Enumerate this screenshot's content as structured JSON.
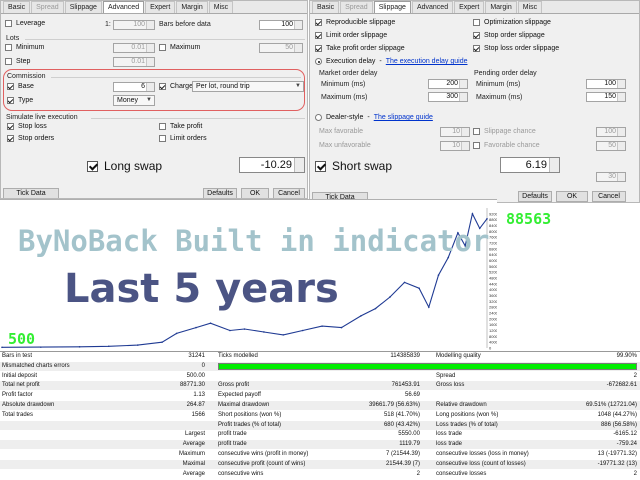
{
  "left_panel": {
    "tabs": [
      {
        "label": "Basic",
        "state": "normal"
      },
      {
        "label": "Spread",
        "state": "disabled"
      },
      {
        "label": "Slippage",
        "state": "normal"
      },
      {
        "label": "Advanced",
        "state": "active"
      },
      {
        "label": "Expert",
        "state": "normal"
      },
      {
        "label": "Margin",
        "state": "normal"
      },
      {
        "label": "Misc",
        "state": "normal"
      }
    ],
    "leverage_label": "Leverage",
    "leverage_ratio": "1:",
    "leverage_value": "100",
    "bars_before_data_label": "Bars before data",
    "bars_before_data_value": "100",
    "lots_label": "Lots",
    "minimum_label": "Minimum",
    "minimum_value": "0.01",
    "maximum_label": "Maximum",
    "maximum_value": "50",
    "step_label": "Step",
    "step_value": "0.01",
    "commission_label": "Commission",
    "base_label": "Base",
    "base_value": "6",
    "charged_label": "Charged",
    "charged_value": "Per lot, round trip",
    "type_label": "Type",
    "type_value": "Money",
    "simulate_label": "Simulate live execution",
    "stop_loss_label": "Stop loss",
    "take_profit_label": "Take profit",
    "stop_orders_label": "Stop orders",
    "limit_orders_label": "Limit orders",
    "long_swap_label": "Long swap",
    "long_swap_value": "-10.29",
    "tick_data_manager": "Tick Data Manager",
    "defaults_label": "Defaults",
    "ok_label": "OK",
    "cancel_label": "Cancel"
  },
  "right_panel": {
    "tabs": [
      {
        "label": "Basic",
        "state": "normal"
      },
      {
        "label": "Spread",
        "state": "disabled"
      },
      {
        "label": "Slippage",
        "state": "active"
      },
      {
        "label": "Advanced",
        "state": "normal"
      },
      {
        "label": "Expert",
        "state": "normal"
      },
      {
        "label": "Margin",
        "state": "normal"
      },
      {
        "label": "Misc",
        "state": "normal"
      }
    ],
    "reproducible_slippage": "Reproducible slippage",
    "optimization_slippage": "Optimization slippage",
    "limit_order_slippage": "Limit order slippage",
    "stop_order_slippage": "Stop order slippage",
    "take_profit_order_slippage": "Take profit order slippage",
    "stop_loss_order_slippage": "Stop loss order slippage",
    "execution_delay": "Execution delay",
    "execution_delay_dash": "-",
    "execution_delay_guide": "The execution delay guide",
    "market_order_delay": "Market order delay",
    "pending_order_delay": "Pending order delay",
    "minimum_ms_label": "Minimum (ms)",
    "maximum_ms_label": "Maximum (ms)",
    "market_min": "200",
    "market_max": "300",
    "pending_min": "100",
    "pending_max": "150",
    "dealer_style": "Dealer-style",
    "dealer_style_dash": "-",
    "slippage_guide": "The slippage guide",
    "max_favorable": "Max favorable",
    "max_favorable_value": "10",
    "slippage_chance": "Slippage chance",
    "slippage_chance_value": "100",
    "max_unfavorable": "Max unfavorable",
    "max_unfavorable_value": "10",
    "favorable_chance": "Favorable chance",
    "favorable_chance_value": "50",
    "extra_value": "30",
    "short_swap_label": "Short swap",
    "short_swap_value": "6.19",
    "tick_data_manager": "Tick Data Manager",
    "defaults_label": "Defaults",
    "ok_label": "OK",
    "cancel_label": "Cancel"
  },
  "overlay": {
    "title": "ByNoBack Built in indicator",
    "subtitle": "Last 5 years",
    "end_value": "88563",
    "start_value": "500"
  },
  "chart_data": {
    "type": "line",
    "title": "",
    "xlabel": "",
    "ylabel": "",
    "ylim": [
      0,
      96000
    ],
    "yticks": [
      0,
      4000,
      8000,
      12000,
      16000,
      20000,
      24000,
      28000,
      32000,
      36000,
      40000,
      44000,
      48000,
      52000,
      56000,
      60000,
      64000,
      68000,
      72000,
      76000,
      80000,
      84000,
      88000,
      92000
    ],
    "x": [
      0,
      0.08,
      0.16,
      0.22,
      0.28,
      0.33,
      0.36,
      0.4,
      0.43,
      0.47,
      0.5,
      0.54,
      0.58,
      0.62,
      0.66,
      0.7,
      0.74,
      0.77,
      0.8,
      0.83,
      0.86,
      0.88,
      0.9,
      0.92,
      0.94,
      0.955,
      0.97,
      0.985,
      1.0
    ],
    "series": [
      {
        "values": [
          500,
          600,
          800,
          1200,
          2000,
          4000,
          10000,
          14000,
          17000,
          12000,
          13000,
          11000,
          9000,
          12000,
          15000,
          14000,
          22000,
          27000,
          35000,
          45000,
          41000,
          28000,
          50000,
          62000,
          79000,
          70000,
          92000,
          82000,
          88563
        ]
      }
    ],
    "line_color": "#1f3a93",
    "grid": false
  },
  "report": {
    "rows": [
      {
        "shade": false,
        "c1l": "Bars in test",
        "c1v": "31241",
        "c2l": "Ticks modelled",
        "c2v": "114385839",
        "c3l": "Modelling quality",
        "c3v": "99.90%"
      },
      {
        "shade": true,
        "c1l": "Mismatched charts errors",
        "c1v": "0",
        "c2l": "",
        "c2v": "",
        "c3l": "",
        "c3v": ""
      },
      {
        "shade": false,
        "c1l": "Initial deposit",
        "c1v": "500.00",
        "c2l": "",
        "c2v": "",
        "c3l": "Spread",
        "c3v": "2"
      },
      {
        "shade": true,
        "c1l": "Total net profit",
        "c1v": "88771.30",
        "c2l": "Gross profit",
        "c2v": "761453.91",
        "c3l": "Gross loss",
        "c3v": "-672682.61"
      },
      {
        "shade": false,
        "c1l": "Profit factor",
        "c1v": "1.13",
        "c2l": "Expected payoff",
        "c2v": "56.69",
        "c3l": "",
        "c3v": ""
      },
      {
        "shade": true,
        "c1l": "Absolute drawdown",
        "c1v": "264.87",
        "c2l": "Maximal drawdown",
        "c2v": "39661.79 (56.63%)",
        "c3l": "Relative drawdown",
        "c3v": "69.51% (12721.04)"
      },
      {
        "shade": false,
        "c1l": "Total trades",
        "c1v": "1566",
        "c2l": "Short positions (won %)",
        "c2v": "518 (41.70%)",
        "c3l": "Long positions (won %)",
        "c3v": "1048 (44.27%)"
      },
      {
        "shade": true,
        "c1l": "",
        "c1v": "",
        "c2l": "Profit trades (% of total)",
        "c2v": "680 (43.42%)",
        "c3l": "Loss trades (% of total)",
        "c3v": "886 (56.58%)"
      },
      {
        "shade": false,
        "c1l": "",
        "c1v": "Largest",
        "c2l": "profit trade",
        "c2v": "5550.00",
        "c3l": "loss trade",
        "c3v": "-6165.12"
      },
      {
        "shade": true,
        "c1l": "",
        "c1v": "Average",
        "c2l": "profit trade",
        "c2v": "1119.79",
        "c3l": "loss trade",
        "c3v": "-759.24"
      },
      {
        "shade": false,
        "c1l": "",
        "c1v": "Maximum",
        "c2l": "consecutive wins (profit in money)",
        "c2v": "7 (21544.39)",
        "c3l": "consecutive losses (loss in money)",
        "c3v": "13 (-19771.32)"
      },
      {
        "shade": true,
        "c1l": "",
        "c1v": "Maximal",
        "c2l": "consecutive profit (count of wins)",
        "c2v": "21544.39 (7)",
        "c3l": "consecutive loss (count of losses)",
        "c3v": "-19771.32 (13)"
      },
      {
        "shade": false,
        "c1l": "",
        "c1v": "Average",
        "c2l": "consecutive wins",
        "c2v": "2",
        "c3l": "consecutive losses",
        "c3v": "2"
      }
    ],
    "modelling_quality_fraction": 0.999
  }
}
